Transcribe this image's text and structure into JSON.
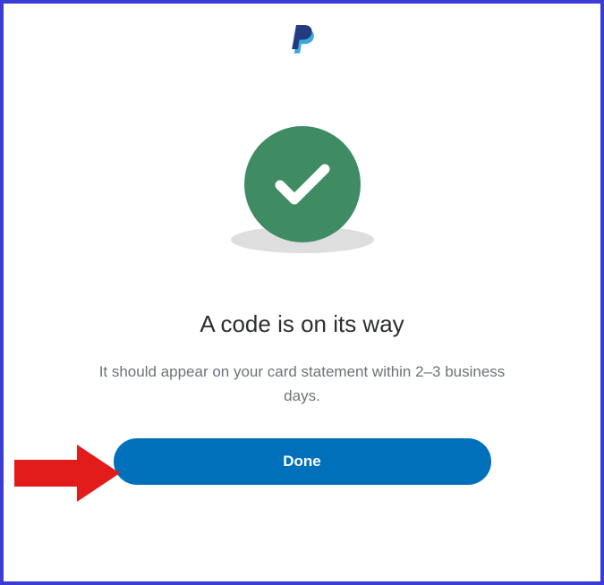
{
  "logo": {
    "name": "paypal-logo-icon"
  },
  "success": {
    "icon_name": "checkmark-icon"
  },
  "heading": "A code is on its way",
  "subtext": "It should appear on your card statement within 2–3 business days.",
  "button": {
    "done_label": "Done"
  },
  "annotation": {
    "arrow_name": "red-arrow-pointer"
  }
}
